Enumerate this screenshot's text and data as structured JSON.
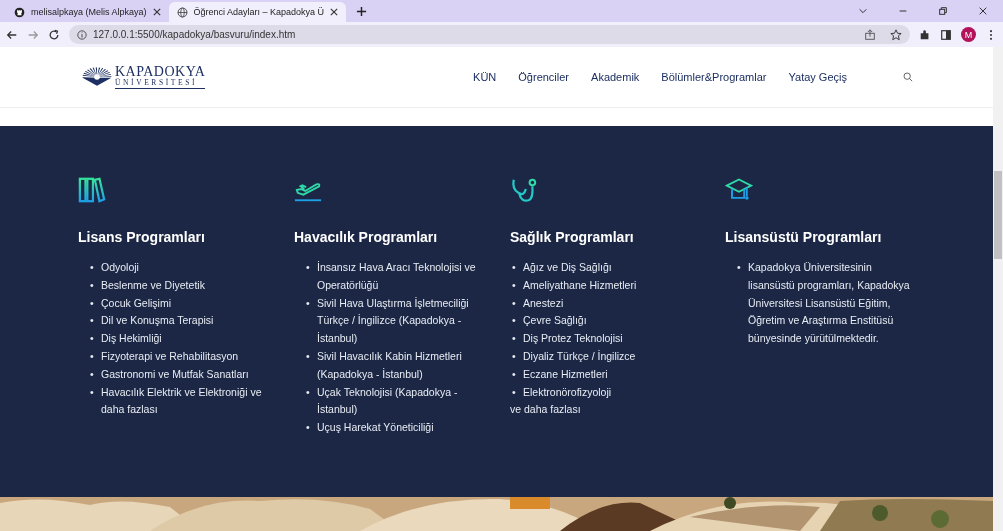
{
  "browser": {
    "tabs": [
      {
        "title": "melisalpkaya (Melis Alpkaya)",
        "selected": false
      },
      {
        "title": "Öğrenci Adayları – Kapadokya Ü",
        "selected": true
      }
    ],
    "url": "127.0.0.1:5500/kapadokya/basvuru/index.htm",
    "profile": "M"
  },
  "header": {
    "logo": {
      "name": "KAPADOKYA",
      "subtitle": "ÜNİVERSİTESİ"
    },
    "nav": [
      {
        "label": "KÜN"
      },
      {
        "label": "Öğrenciler"
      },
      {
        "label": "Akademik"
      },
      {
        "label": "Bölümler&Programlar"
      },
      {
        "label": "Yatay Geçiş"
      }
    ]
  },
  "programs": [
    {
      "bullet": "•",
      "title": "Lisans Programları",
      "items": [
        "Odyoloji",
        "Beslenme ve Diyetetik",
        "Çocuk Gelişimi",
        "Dil ve Konuşma Terapisi",
        "Diş Hekimliği",
        "Fizyoterapi ve Rehabilitasyon",
        "Gastronomi ve Mutfak Sanatları",
        "Havacılık Elektrik ve Elektroniği ve daha fazlası"
      ]
    },
    {
      "bullet": "•",
      "title": "Havacılık Programları",
      "items": [
        "İnsansız Hava Aracı Teknolojisi ve Operatörlüğü",
        "Sivil Hava Ulaştırma İşletmeciliği Türkçe / İngilizce (Kapadokya - İstanbul)",
        "Sivil Havacılık Kabin Hizmetleri (Kapadokya - İstanbul)",
        "Uçak Teknolojisi (Kapadokya - İstanbul)",
        "Uçuş Harekat Yöneticiliği"
      ]
    },
    {
      "bullet": "•",
      "title": "Sağlık Programları",
      "items": [
        "Ağız ve Diş Sağlığı",
        "Ameliyathane Hizmetleri",
        "Anestezi",
        "Çevre Sağlığı",
        "Diş Protez Teknolojisi",
        "Diyaliz Türkçe / İngilizce",
        "Eczane Hizmetleri",
        "Elektronörofizyoloji"
      ],
      "more": "ve daha fazlası"
    },
    {
      "bullet": "•",
      "title": "Lisansüstü Programları",
      "items": [
        "Kapadokya Üniversitesinin lisansüstü programları, Kapadokya Üniversitesi Lisansüstü Eğitim, Öğretim ve Araştırma Enstitüsü bünyesinde yürütülmektedir."
      ]
    }
  ]
}
